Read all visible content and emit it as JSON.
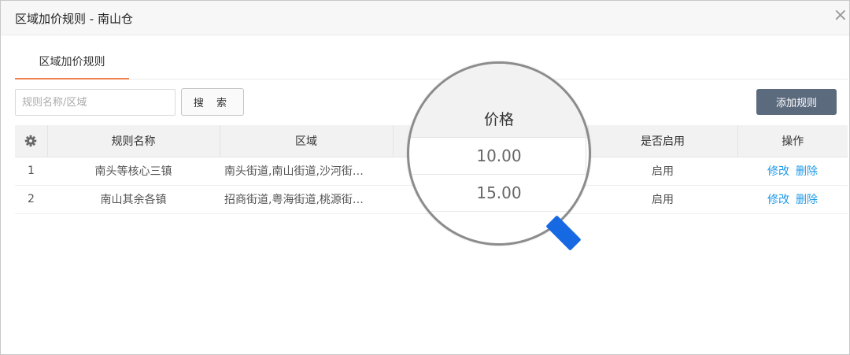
{
  "dialog": {
    "title": "区域加价规则 - 南山仓",
    "close_glyph": "×"
  },
  "tabs": [
    {
      "label": "区域加价规则"
    }
  ],
  "search": {
    "placeholder": "规则名称/区域",
    "button_label": "搜 索"
  },
  "toolbar": {
    "add_label": "添加规则"
  },
  "table": {
    "headers": {
      "rule_name": "规则名称",
      "area": "区域",
      "enabled": "是否启用",
      "actions": "操作"
    },
    "rows": [
      {
        "index": "1",
        "rule_name": "南头等核心三镇",
        "area": "南头街道,南山街道,沙河街…",
        "enabled": "启用",
        "edit": "修改",
        "delete": "删除"
      },
      {
        "index": "2",
        "rule_name": "南山其余各镇",
        "area": "招商街道,粤海街道,桃源街…",
        "enabled": "启用",
        "edit": "修改",
        "delete": "删除"
      }
    ]
  },
  "magnifier": {
    "header": "价格",
    "values": [
      "10.00",
      "15.00"
    ]
  },
  "colors": {
    "tab_accent": "#f0834f",
    "add_button": "#5c6a7e",
    "enabled_text": "#2aa92a",
    "link_text": "#1e9ae8",
    "magnifier_handle": "#1668e3"
  },
  "icons": {
    "settings_column": "gear-icon",
    "close": "close-icon",
    "magnifier": "magnifier-icon"
  }
}
